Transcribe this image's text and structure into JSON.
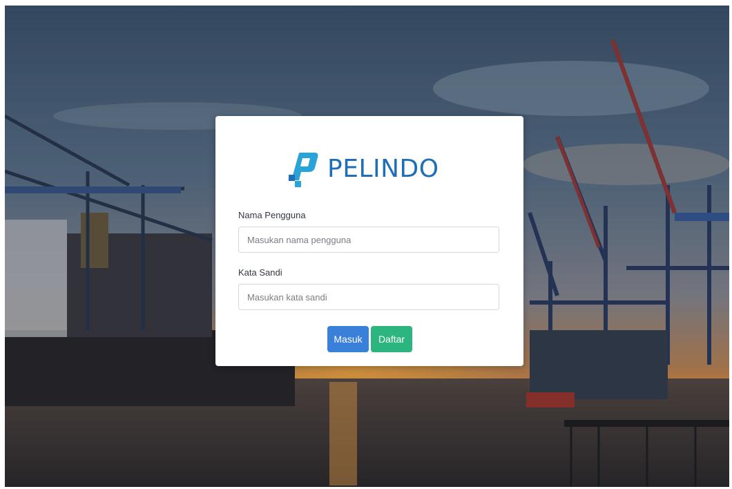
{
  "brand": {
    "name": "PELINDO",
    "icon": "pelindo-logo-mark",
    "color": "#1f6fb8"
  },
  "form": {
    "username": {
      "label": "Nama Pengguna",
      "value": "",
      "placeholder": "Masukan nama pengguna"
    },
    "password": {
      "label": "Kata Sandi",
      "value": "",
      "placeholder": "Masukan kata sandi"
    }
  },
  "actions": {
    "login_label": "Masuk",
    "login_color": "#3a7fd8",
    "register_label": "Daftar",
    "register_color": "#2cb57e"
  },
  "background": {
    "description_icon": "harbor-sunset-background"
  }
}
